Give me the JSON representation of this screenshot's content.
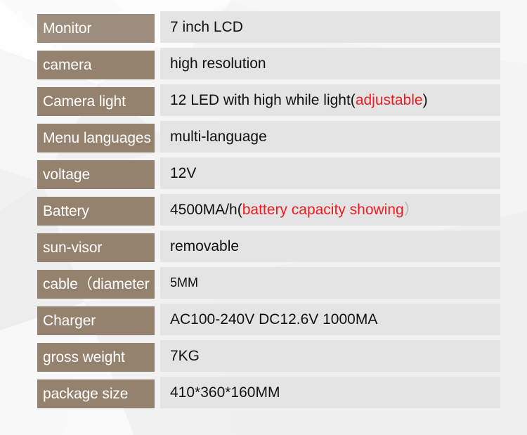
{
  "theme": {
    "label_bg": "#95826e",
    "label_bg_first": "#9d8d7c",
    "value_bg": "#e4e4e4",
    "label_text": "#ffffff",
    "value_text": "#111111",
    "accent_red": "#ee1c22",
    "paren_gray": "#b9b9b9",
    "page_bg": "#f1f1f1"
  },
  "spec_table": {
    "rows": [
      {
        "label": "Monitor",
        "value": "7 inch LCD",
        "value_red": "",
        "value_tail": "",
        "value_paren": ""
      },
      {
        "label": "camera",
        "value": "high resolution",
        "value_red": "",
        "value_tail": "",
        "value_paren": ""
      },
      {
        "label": "Camera light",
        "value": "12 LED with high while light(",
        "value_red": "adjustable",
        "value_tail": ")",
        "value_paren": ""
      },
      {
        "label": "Menu languages",
        "value": "multi-language",
        "value_red": "",
        "value_tail": "",
        "value_paren": ""
      },
      {
        "label": "voltage",
        "value": "12V",
        "value_red": "",
        "value_tail": "",
        "value_paren": ""
      },
      {
        "label": "Battery",
        "value": "4500MA/h(",
        "value_red": "battery capacity showing",
        "value_tail": "",
        "value_paren": "）"
      },
      {
        "label": "sun-visor",
        "value": "removable",
        "value_red": "",
        "value_tail": "",
        "value_paren": ""
      },
      {
        "label": "cable（diameter",
        "value": "5MM",
        "value_red": "",
        "value_tail": "",
        "value_paren": "",
        "value_small": true
      },
      {
        "label": "Charger",
        "value": "AC100-240V  DC12.6V 1000MA",
        "value_red": "",
        "value_tail": "",
        "value_paren": ""
      },
      {
        "label": "gross weight",
        "value": "7KG",
        "value_red": "",
        "value_tail": "",
        "value_paren": ""
      },
      {
        "label": "package size",
        "value": "410*360*160MM",
        "value_red": "",
        "value_tail": "",
        "value_paren": ""
      }
    ]
  }
}
